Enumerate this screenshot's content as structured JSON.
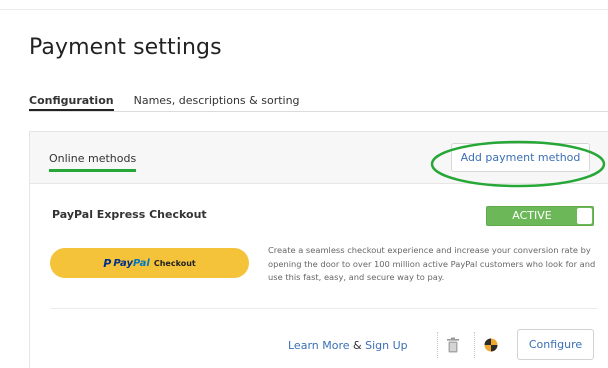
{
  "page": {
    "title": "Payment settings"
  },
  "tabs": [
    {
      "label": "Configuration",
      "active": true
    },
    {
      "label": "Names, descriptions & sorting",
      "active": false
    }
  ],
  "panel": {
    "section_label": "Online methods",
    "add_button_label": "Add payment method",
    "highlight_color": "#27a737"
  },
  "method": {
    "title": "PayPal Express Checkout",
    "status": "ACTIVE",
    "status_color": "#6cb859",
    "paypal_button": {
      "brand_p": "P",
      "brand_pay": "Pay",
      "brand_pal": "Pal",
      "suffix": "Checkout",
      "background_color": "#f4c33a"
    },
    "description": "Create a seamless checkout experience and increase your conversion rate by opening the door to over 100 million active PayPal customers who look for and use this fast, easy, and secure way to pay.",
    "learn_more_label": "Learn More",
    "ampersand": "&",
    "sign_up_label": "Sign Up",
    "configure_label": "Configure",
    "icons": {
      "delete": "trash-icon",
      "settings": "pie-chart-icon"
    }
  }
}
